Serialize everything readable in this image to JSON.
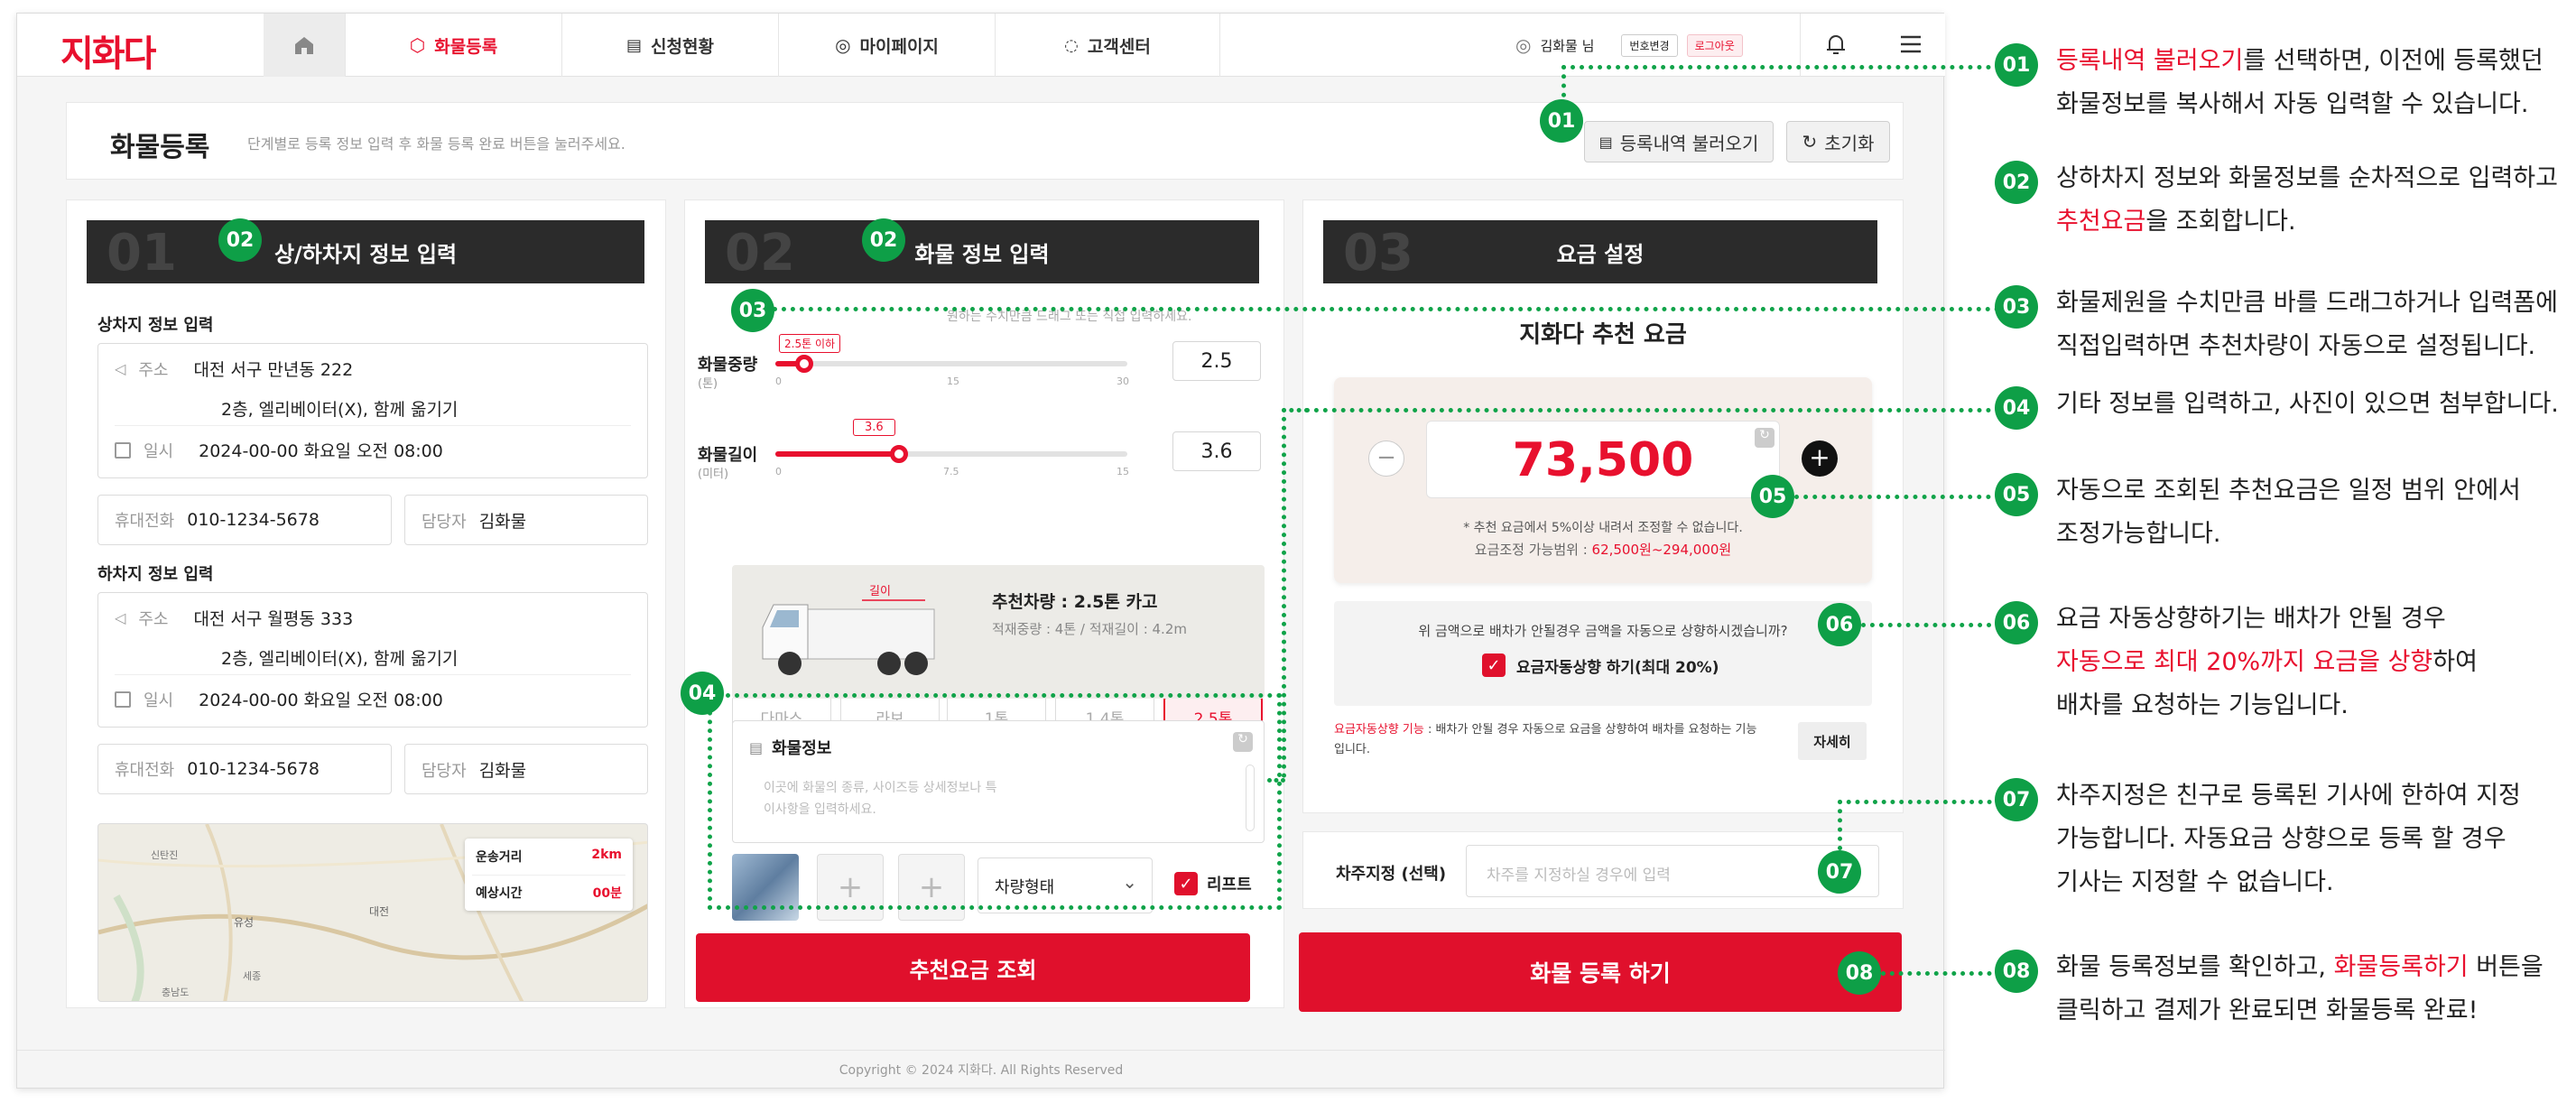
{
  "brand": {
    "logo": "지화다",
    "accent": "#e8102e",
    "annotation_green": "#0e9f47"
  },
  "nav": {
    "tabs": [
      "화물등록",
      "신청현황",
      "마이페이지",
      "고객센터"
    ],
    "user": "김화물 님",
    "change_number": "번호변경",
    "logout": "로그아웃"
  },
  "header": {
    "title": "화물등록",
    "subtitle": "단계별로 등록 정보 입력 후 화물 등록 완료 버튼을 눌러주세요.",
    "load_button": "등록내역 불러오기",
    "reset_button": "초기화"
  },
  "step1": {
    "num": "01",
    "title": "상/하차지 정보 입력",
    "pickup": {
      "heading": "상차지 정보 입력",
      "address_label": "주소",
      "address": "대전 서구 만년동 222",
      "detail": "2층, 엘리베이터(X), 함께 옮기기",
      "date_label": "일시",
      "date": "2024-00-00 화요일 오전 08:00",
      "phone_label": "휴대전화",
      "phone": "010-1234-5678",
      "manager_label": "담당자",
      "manager": "김화물"
    },
    "dropoff": {
      "heading": "하차지 정보 입력",
      "address_label": "주소",
      "address": "대전 서구 월평동 333",
      "detail": "2층, 엘리베이터(X), 함께 옮기기",
      "date_label": "일시",
      "date": "2024-00-00 화요일 오전 08:00",
      "phone_label": "휴대전화",
      "phone": "010-1234-5678",
      "manager_label": "담당자",
      "manager": "김화물"
    },
    "map": {
      "distance_label": "운송거리",
      "distance": "2km",
      "time_label": "예상시간",
      "time": "00분",
      "places": [
        "대전",
        "유성",
        "신탄진",
        "세종",
        "충남도"
      ]
    }
  },
  "step2": {
    "num": "02",
    "title": "화물 정보 입력",
    "hint": "원하는 수치만큼 드래그 또는 직접 입력하세요.",
    "weight": {
      "label": "화물중량",
      "unit": "(톤)",
      "tooltip": "2.5톤 이하",
      "value": "2.5",
      "ticks": [
        "0",
        "15",
        "30"
      ],
      "fraction": 0.083
    },
    "length": {
      "label": "화물길이",
      "unit": "(미터)",
      "tooltip": "3.6",
      "value": "3.6",
      "ticks": [
        "0",
        "7.5",
        "15"
      ],
      "fraction": 0.35
    },
    "sizes": [
      "다마스",
      "라보",
      "1톤",
      "1.4톤",
      "2.5톤"
    ],
    "selected_size": "2.5톤",
    "truck": {
      "length_tag": "길이",
      "name": "추천차량 : 2.5톤 카고",
      "spec": "적재중량 : 4톤 / 적재길이 : 4.2m"
    },
    "cargo_info": {
      "label": "화물정보",
      "placeholder": "이곳에 화물의 종류, 사이즈등 상세정보나 특이사항을 입력하세요."
    },
    "vehicle_type": "차량형태",
    "lift": "리프트",
    "search_button": "추천요금 조회"
  },
  "step3": {
    "num": "03",
    "title": "요금 설정",
    "rec_title": "지화다 추천 요금",
    "fare": "73,500",
    "note": "* 추천 요금에서 5%이상 내려서 조정할 수 없습니다.",
    "range_label": "요금조정 가능범위 : ",
    "range": "62,500원~294,000원",
    "auto_q": "위 금액으로 배차가 안될경우 금액을 자동으로 상향하시겠습니까?",
    "auto_check": "요금자동상향 하기(최대 20%)",
    "auto_desc_title": "요금자동상향 기능",
    "auto_desc": " : 배차가 안될 경우 자동으로 요금을 상향하여 배차를 요청하는 기능입니다.",
    "detail_button": "자세히",
    "driver_label": "차주지정 (선택)",
    "driver_placeholder": "차주를 지정하실 경우에 입력",
    "register_button": "화물 등록 하기"
  },
  "footer": "Copyright © 2024 지화다. All Rights Reserved",
  "annotations": [
    {
      "n": "01",
      "l1": [
        {
          "t": "등록내역 불러오기",
          "r": true
        },
        {
          "t": "를 선택하면, 이전에 등록했던",
          "r": false
        }
      ],
      "l2": "화물정보를 복사해서 자동 입력할 수 있습니다."
    },
    {
      "n": "02",
      "l1": [
        {
          "t": "상하차지 정보와 화물정보를 순차적으로 입력하고",
          "r": false
        }
      ],
      "l2a": "추천요금",
      "l2b": "을 조회합니다."
    },
    {
      "n": "03",
      "l1": [
        {
          "t": "화물제원을 수치만큼 바를 드래그하거나 입력폼에",
          "r": false
        }
      ],
      "l2": "직접입력하면  추천차량이 자동으로 설정됩니다."
    },
    {
      "n": "04",
      "l1": [
        {
          "t": "기타 정보를 입력하고, 사진이 있으면 첨부합니다.",
          "r": false
        }
      ]
    },
    {
      "n": "05",
      "l1": [
        {
          "t": "자동으로 조회된 추천요금은 일정 범위 안에서",
          "r": false
        }
      ],
      "l2": "조정가능합니다."
    },
    {
      "n": "06",
      "l1": [
        {
          "t": "요금 자동상향하기는 배차가 안될 경우",
          "r": false
        }
      ],
      "l2a": "자동으로 최대 20%까지 요금을 상향",
      "l2b": "하여",
      "l3": "배차를 요청하는 기능입니다."
    },
    {
      "n": "07",
      "l1": [
        {
          "t": "차주지정은 친구로 등록된 기사에 한하여 지정",
          "r": false
        }
      ],
      "l2": "가능합니다. 자동요금 상향으로 등록 할 경우",
      "l3": "기사는 지정할 수 없습니다."
    },
    {
      "n": "08",
      "l1": [
        {
          "t": "화물 등록정보를 확인하고, ",
          "r": false
        },
        {
          "t": "화물등록하기",
          "r": true
        },
        {
          "t": " 버튼을",
          "r": false
        }
      ],
      "l2": "클릭하고 결제가 완료되면 화물등록 완료!"
    }
  ]
}
